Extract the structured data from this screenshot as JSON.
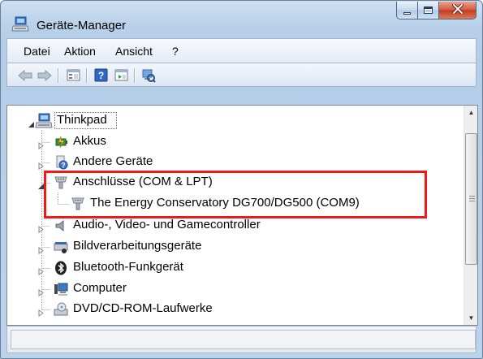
{
  "window": {
    "title": "Geräte-Manager"
  },
  "menu": [
    "Datei",
    "Aktion",
    "Ansicht",
    "?"
  ],
  "toolbar": {
    "buttons": [
      "back-icon",
      "forward-icon",
      "properties-icon",
      "help-icon",
      "view-icon",
      "scan-hardware-icon"
    ]
  },
  "tree": {
    "root": "Thinkpad",
    "items": [
      {
        "label": "Akkus",
        "icon": "battery-icon"
      },
      {
        "label": "Andere Geräte",
        "icon": "unknown-device-icon"
      },
      {
        "label": "Anschlüsse (COM & LPT)",
        "icon": "port-icon",
        "expanded": true
      },
      {
        "label": "The Energy Conservatory DG700/DG500 (COM9)",
        "icon": "port-icon",
        "child": true
      },
      {
        "label": "Audio-, Video- und Gamecontroller",
        "icon": "speaker-icon"
      },
      {
        "label": "Bildverarbeitungsgeräte",
        "icon": "scanner-icon"
      },
      {
        "label": "Bluetooth-Funkgerät",
        "icon": "bluetooth-icon"
      },
      {
        "label": "Computer",
        "icon": "computer-icon"
      },
      {
        "label": "DVD/CD-ROM-Laufwerke",
        "icon": "dvd-drive-icon"
      }
    ]
  },
  "colors": {
    "highlight": "#ee1a1a",
    "close_button": "#c9462a",
    "window_frame": "#b9d1ea"
  }
}
